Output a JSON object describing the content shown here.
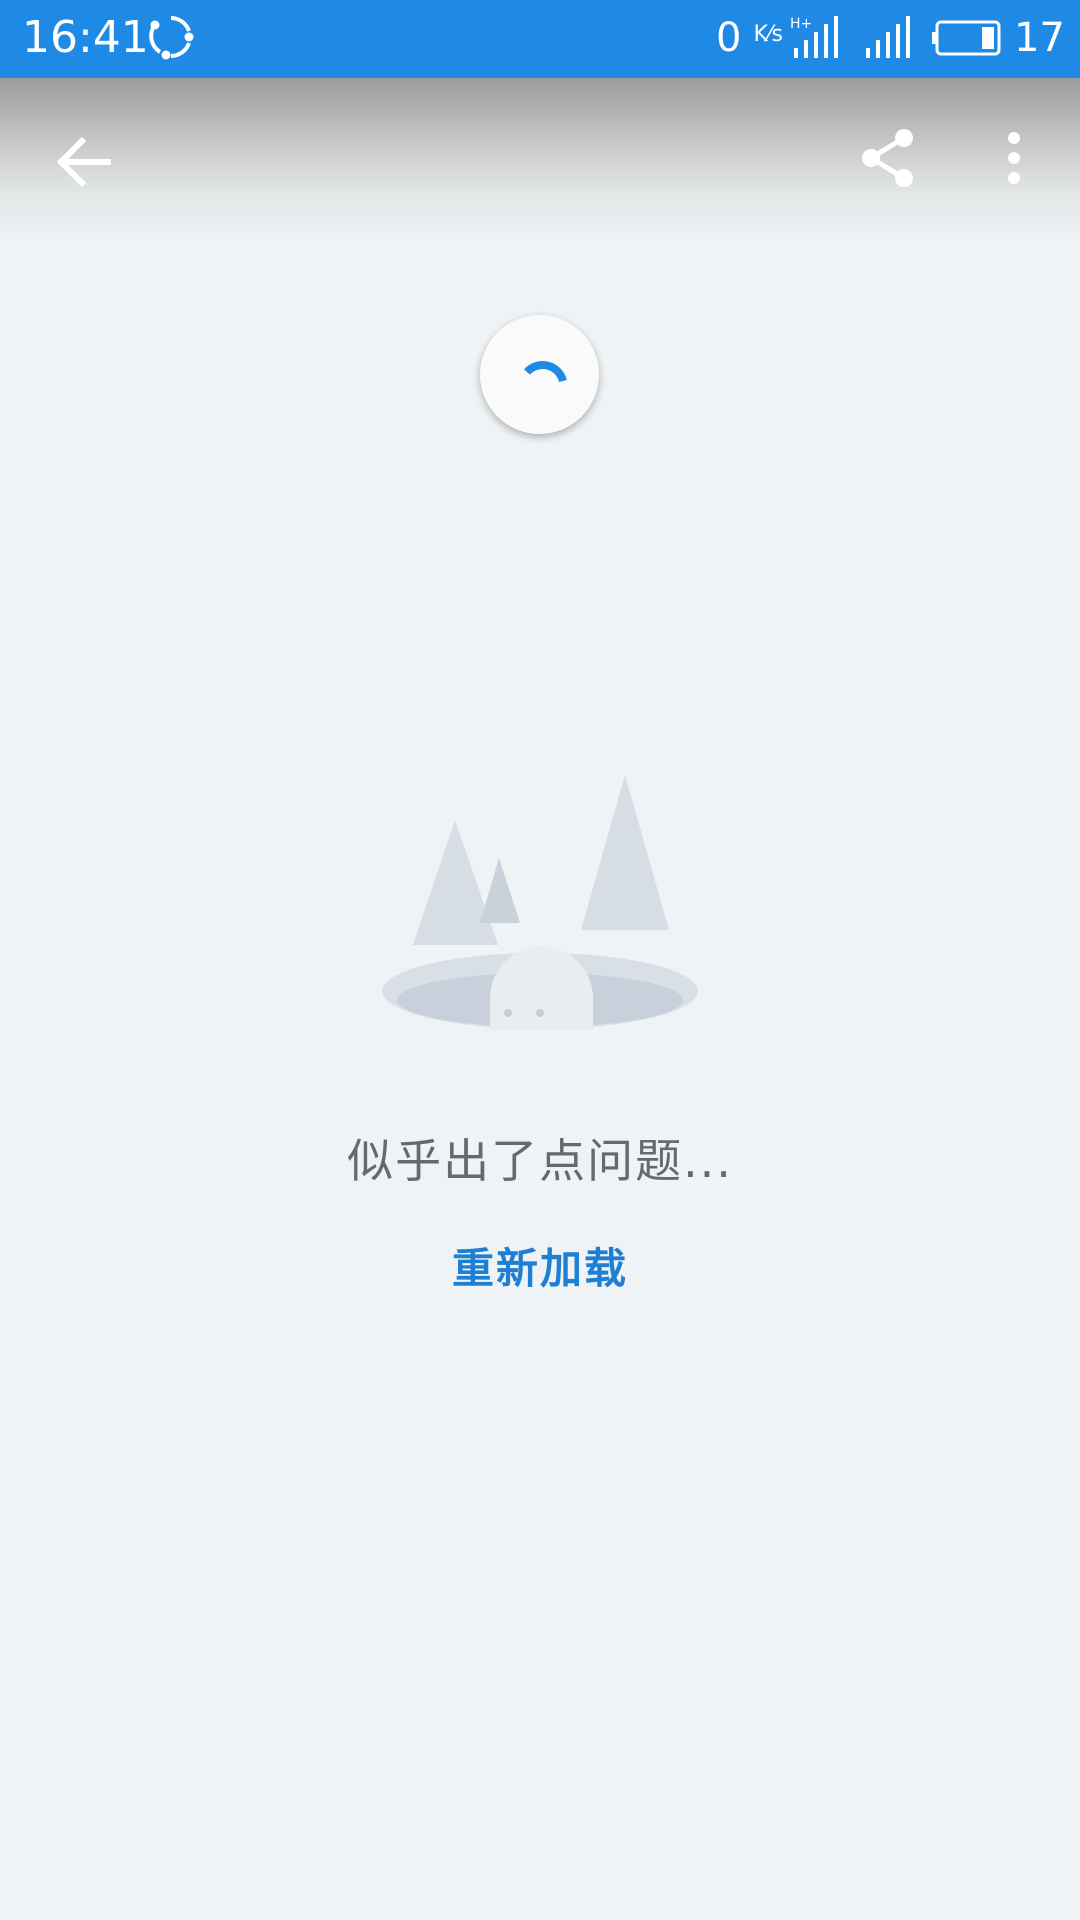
{
  "status_bar": {
    "time": "16:41",
    "net_speed_value": "0",
    "net_speed_unit": "K⁄s",
    "network_type": "H+",
    "battery_level": "17",
    "icons": [
      "sync-icon",
      "signal-icon",
      "signal-icon",
      "battery-icon"
    ]
  },
  "app_bar": {
    "icons": [
      "back-arrow-icon",
      "share-icon",
      "more-vert-icon"
    ]
  },
  "colors": {
    "status_bar": "#1f8ae5",
    "background": "#eff3f5",
    "accent": "#1f7fd3",
    "message_text": "#666a6e"
  },
  "error": {
    "message": "似乎出了点问题...",
    "reload_label": "重新加载"
  }
}
